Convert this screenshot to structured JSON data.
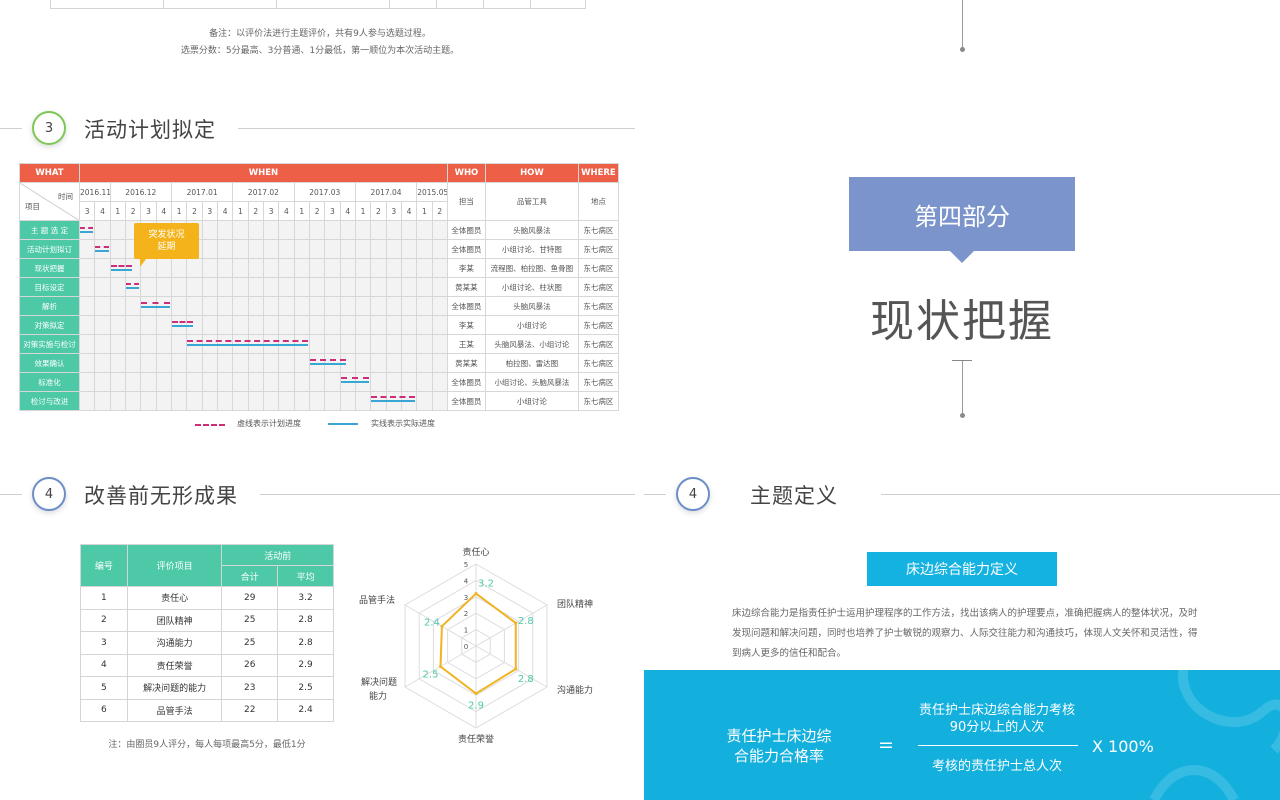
{
  "top_notes": {
    "line1": "备注：以评价法进行主题评价，共有9人参与选题过程。",
    "line2": "选票分数：5分最高、3分普通、1分最低，第一顺位为本次活动主题。"
  },
  "section3": {
    "number": "3",
    "title": "活动计划拟定"
  },
  "gantt": {
    "head": {
      "what": "WHAT",
      "when": "WHEN",
      "who": "WHO",
      "how": "HOW",
      "where": "WHERE"
    },
    "corner": {
      "time": "时间",
      "item": "项目"
    },
    "months": [
      "2016.11",
      "2016.12",
      "2017.01",
      "2017.02",
      "2017.03",
      "2017.04",
      "2015.05"
    ],
    "weeks": [
      "3",
      "4",
      "1",
      "2",
      "3",
      "4",
      "1",
      "2",
      "3",
      "4",
      "1",
      "2",
      "3",
      "4",
      "1",
      "2",
      "3",
      "4",
      "1",
      "2",
      "3",
      "4",
      "1",
      "2"
    ],
    "sub": {
      "who": "担当",
      "how": "品管工具",
      "where": "地点"
    },
    "rows": [
      {
        "task": "主 题 选 定",
        "who": "全体圈员",
        "how": "头脑风暴法",
        "where": "东七病区"
      },
      {
        "task": "活动计划拟订",
        "who": "全体圈员",
        "how": "小组讨论、甘特图",
        "where": "东七病区"
      },
      {
        "task": "现状把握",
        "who": "李某",
        "how": "流程图、柏拉图、鱼骨图",
        "where": "东七病区"
      },
      {
        "task": "目标设定",
        "who": "黄某某",
        "how": "小组讨论、柱状图",
        "where": "东七病区"
      },
      {
        "task": "解析",
        "who": "全体圈员",
        "how": "头脑风暴法",
        "where": "东七病区"
      },
      {
        "task": "对策拟定",
        "who": "李某",
        "how": "小组讨论",
        "where": "东七病区"
      },
      {
        "task": "对策实施与检讨",
        "who": "王某",
        "how": "头脑风暴法、小组讨论",
        "where": "东七病区"
      },
      {
        "task": "效果确认",
        "who": "黄某某",
        "how": "柏拉图、雷达图",
        "where": "东七病区"
      },
      {
        "task": "标准化",
        "who": "全体圈员",
        "how": "小组讨论、头脑风暴法",
        "where": "东七病区"
      },
      {
        "task": "检讨与改进",
        "who": "全体圈员",
        "how": "小组讨论",
        "where": "东七病区"
      }
    ],
    "bars": [
      {
        "row": 0,
        "start": 0,
        "end": 1
      },
      {
        "row": 1,
        "start": 1,
        "end": 2
      },
      {
        "row": 2,
        "start": 2,
        "end": 3.5
      },
      {
        "row": 3,
        "start": 3,
        "end": 4
      },
      {
        "row": 4,
        "start": 4,
        "end": 6
      },
      {
        "row": 5,
        "start": 6,
        "end": 7.5
      },
      {
        "row": 6,
        "start": 7,
        "end": 15
      },
      {
        "row": 7,
        "start": 15,
        "end": 17.5
      },
      {
        "row": 8,
        "start": 17,
        "end": 19
      },
      {
        "row": 9,
        "start": 19,
        "end": 22
      }
    ],
    "callout": "突发状况\n延期",
    "legend": {
      "plan": "虚线表示计划进度",
      "actual": "实线表示实际进度"
    }
  },
  "section4_left": {
    "number": "4",
    "title": "改善前无形成果"
  },
  "score_table": {
    "head": {
      "no": "编号",
      "item": "评价项目",
      "group": "活动前",
      "sum": "合计",
      "avg": "平均"
    },
    "rows": [
      {
        "no": "1",
        "item": "责任心",
        "sum": "29",
        "avg": "3.2"
      },
      {
        "no": "2",
        "item": "团队精神",
        "sum": "25",
        "avg": "2.8"
      },
      {
        "no": "3",
        "item": "沟通能力",
        "sum": "25",
        "avg": "2.8"
      },
      {
        "no": "4",
        "item": "责任荣誉",
        "sum": "26",
        "avg": "2.9"
      },
      {
        "no": "5",
        "item": "解决问题的能力",
        "sum": "23",
        "avg": "2.5"
      },
      {
        "no": "6",
        "item": "品管手法",
        "sum": "22",
        "avg": "2.4"
      }
    ],
    "note": "注：由圈员9人评分，每人每项最高5分，最低1分"
  },
  "chart_data": {
    "type": "radar",
    "categories": [
      "责任心",
      "团队精神",
      "沟通能力",
      "责任荣誉",
      "解决问题能力",
      "品管手法"
    ],
    "values": [
      3.2,
      2.8,
      2.8,
      2.9,
      2.5,
      2.4
    ],
    "value_labels": [
      "3.2",
      "2.8",
      "2.8",
      "2.9",
      "2.5",
      "2.4"
    ],
    "rlim": [
      0,
      5
    ],
    "ticks": [
      "0",
      "1",
      "2",
      "3",
      "4",
      "5"
    ],
    "colors": {
      "series": "#f0b323",
      "grid": "#dddddd",
      "label": "#4dc9a8"
    }
  },
  "right": {
    "part": "第四部分",
    "title": "现状把握",
    "section": {
      "number": "4",
      "title": "主题定义"
    },
    "def_title": "床边综合能力定义",
    "def_text": "床边综合能力是指责任护士运用护理程序的工作方法，找出该病人的护理要点，准确把握病人的整体状况，及时发现问题和解决问题，同时也培养了护士敏锐的观察力、人际交往能力和沟通技巧，体现人文关怀和灵活性，得到病人更多的信任和配合。",
    "formula": {
      "lhs": "责任护士床边综合能力合格率",
      "eq": "=",
      "numerator": "责任护士床边综合能力考核90分以上的人次",
      "denominator": "考核的责任护士总人次",
      "times": "X 100%"
    }
  }
}
